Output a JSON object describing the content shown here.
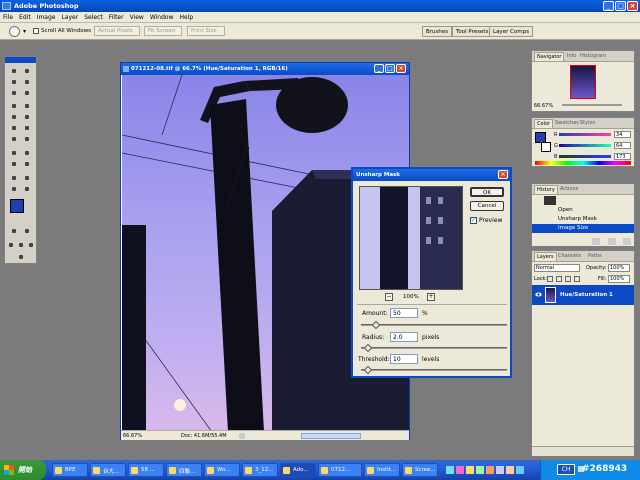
{
  "app": {
    "title": "Adobe Photoshop",
    "menu": [
      "File",
      "Edit",
      "Image",
      "Layer",
      "Select",
      "Filter",
      "View",
      "Window",
      "Help"
    ]
  },
  "options_bar": {
    "scroll_all_windows": "Scroll All Windows",
    "actual_pixels": "Actual Pixels",
    "fit_screen": "Fit Screen",
    "print_size": "Print Size",
    "palette_tabs": [
      "Brushes",
      "Tool Presets",
      "Layer Comps"
    ]
  },
  "document": {
    "title": "071212-08.tif @ 66.7% (Hue/Saturation 1, RGB/16)",
    "zoom": "66.67%",
    "doc_info": "Doc: 41.6M/55.4M"
  },
  "dialog": {
    "title": "Unsharp Mask",
    "ok": "OK",
    "cancel": "Cancel",
    "preview": "Preview",
    "preview_checked": true,
    "zoom_minus": "−",
    "zoom_plus": "+",
    "zoom": "100%",
    "amount_label": "Amount:",
    "amount": "50",
    "amount_unit": "%",
    "amount_value": 0.1,
    "radius_label": "Radius:",
    "radius": "2.0",
    "radius_unit": "pixels",
    "radius_value": 0.05,
    "threshold_label": "Threshold:",
    "threshold": "10",
    "threshold_unit": "levels",
    "threshold_value": 0.05
  },
  "navigator": {
    "tabs": [
      "Navigator",
      "Info",
      "Histogram"
    ],
    "zoom": "66.67%"
  },
  "color": {
    "tabs": [
      "Color",
      "Swatches",
      "Styles"
    ],
    "r_label": "R",
    "r": "34",
    "g_label": "G",
    "g": "64",
    "b_label": "B",
    "b": "173"
  },
  "history": {
    "tabs": [
      "History",
      "Actions"
    ],
    "items": [
      "Open",
      "Unsharp Mask",
      "Image Size"
    ]
  },
  "layers": {
    "tabs": [
      "Layers",
      "Channels",
      "Paths"
    ],
    "blend": "Normal",
    "opacity_label": "Opacity:",
    "opacity": "100%",
    "lock_label": "Lock:",
    "fill_label": "Fill:",
    "fill": "100%",
    "layer_name": "Hue/Saturation 1"
  },
  "taskbar": {
    "start": "開始",
    "tasks": [
      "BPE",
      "台大...",
      "58 ...",
      "四聯...",
      "Wo...",
      "3_12...",
      "Ado...",
      "0712...",
      "Instit...",
      "Scree..."
    ],
    "lang": "CH"
  },
  "watermark": "#268943",
  "colors": {
    "fg_swatch": "#2240ad",
    "accent": "#0b4ac4"
  }
}
